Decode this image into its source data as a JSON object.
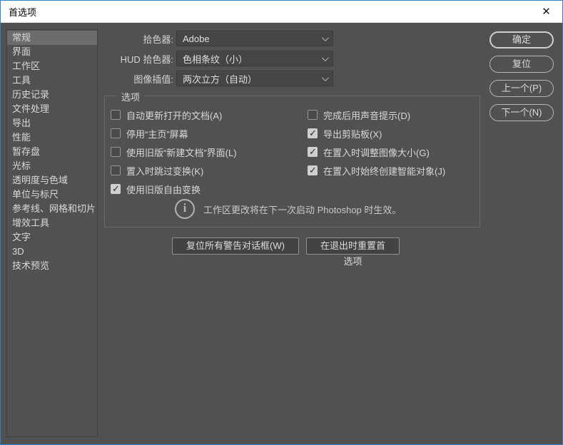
{
  "window": {
    "title": "首选项"
  },
  "sidebar": {
    "items": [
      {
        "label": "常规",
        "selected": true
      },
      {
        "label": "界面"
      },
      {
        "label": "工作区"
      },
      {
        "label": "工具"
      },
      {
        "label": "历史记录"
      },
      {
        "label": "文件处理"
      },
      {
        "label": "导出"
      },
      {
        "label": "性能"
      },
      {
        "label": "暂存盘"
      },
      {
        "label": "光标"
      },
      {
        "label": "透明度与色域"
      },
      {
        "label": "单位与标尺"
      },
      {
        "label": "参考线、网格和切片"
      },
      {
        "label": "增效工具"
      },
      {
        "label": "文字"
      },
      {
        "label": "3D"
      },
      {
        "label": "技术预览"
      }
    ]
  },
  "dropdowns": [
    {
      "label": "拾色器:",
      "value": "Adobe"
    },
    {
      "label": "HUD 拾色器:",
      "value": "色相条纹（小）"
    },
    {
      "label": "图像插值:",
      "value": "两次立方（自动）"
    }
  ],
  "options_group": {
    "legend": "选项",
    "left": [
      {
        "label": "自动更新打开的文档(A)",
        "checked": false
      },
      {
        "label": "停用“主页”屏幕",
        "checked": false
      },
      {
        "label": "使用旧版“新建文档”界面(L)",
        "checked": false
      },
      {
        "label": "置入时跳过变换(K)",
        "checked": false
      },
      {
        "label": "使用旧版自由变换",
        "checked": true
      }
    ],
    "right": [
      {
        "label": "完成后用声音提示(D)",
        "checked": false
      },
      {
        "label": "导出剪贴板(X)",
        "checked": true
      },
      {
        "label": "在置入时调整图像大小(G)",
        "checked": true
      },
      {
        "label": "在置入时始终创建智能对象(J)",
        "checked": true
      }
    ],
    "notice": "工作区更改将在下一次启动 Photoshop 时生效。"
  },
  "footer_buttons": {
    "reset_warnings": "复位所有警告对话框(W)",
    "reset_on_quit": "在退出时重置首选项"
  },
  "action_buttons": {
    "ok": "确定",
    "reset": "复位",
    "prev": "上一个(P)",
    "next": "下一个(N)"
  },
  "colors": {
    "accent_border": "#2a85d5",
    "panel": "#515151",
    "selected_item": "#6c6c6c",
    "text": "#d8d8d8"
  }
}
